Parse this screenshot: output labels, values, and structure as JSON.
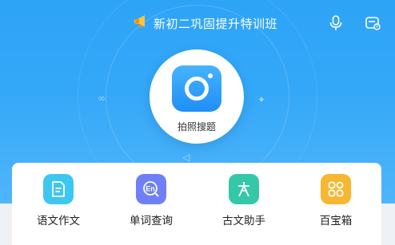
{
  "header": {
    "title": "新初二巩固提升特训班",
    "icons": [
      "megaphone-icon",
      "microphone-icon",
      "message-icon"
    ]
  },
  "camera": {
    "label": "拍照搜题",
    "icon": "camera-icon"
  },
  "tools": [
    {
      "label": "语文作文",
      "icon": "document-icon",
      "color": "#3dc7f0"
    },
    {
      "label": "单词查询",
      "icon": "english-search-icon",
      "color": "#6f7ff5"
    },
    {
      "label": "古文助手",
      "icon": "scholar-icon",
      "color": "#35c8a8"
    },
    {
      "label": "百宝箱",
      "icon": "grid-icon",
      "color": "#f7b733"
    }
  ],
  "colors": {
    "hero_top": "#2ea4f7",
    "hero_bottom": "#4fb5fa",
    "panel_bg": "#ffffff"
  }
}
